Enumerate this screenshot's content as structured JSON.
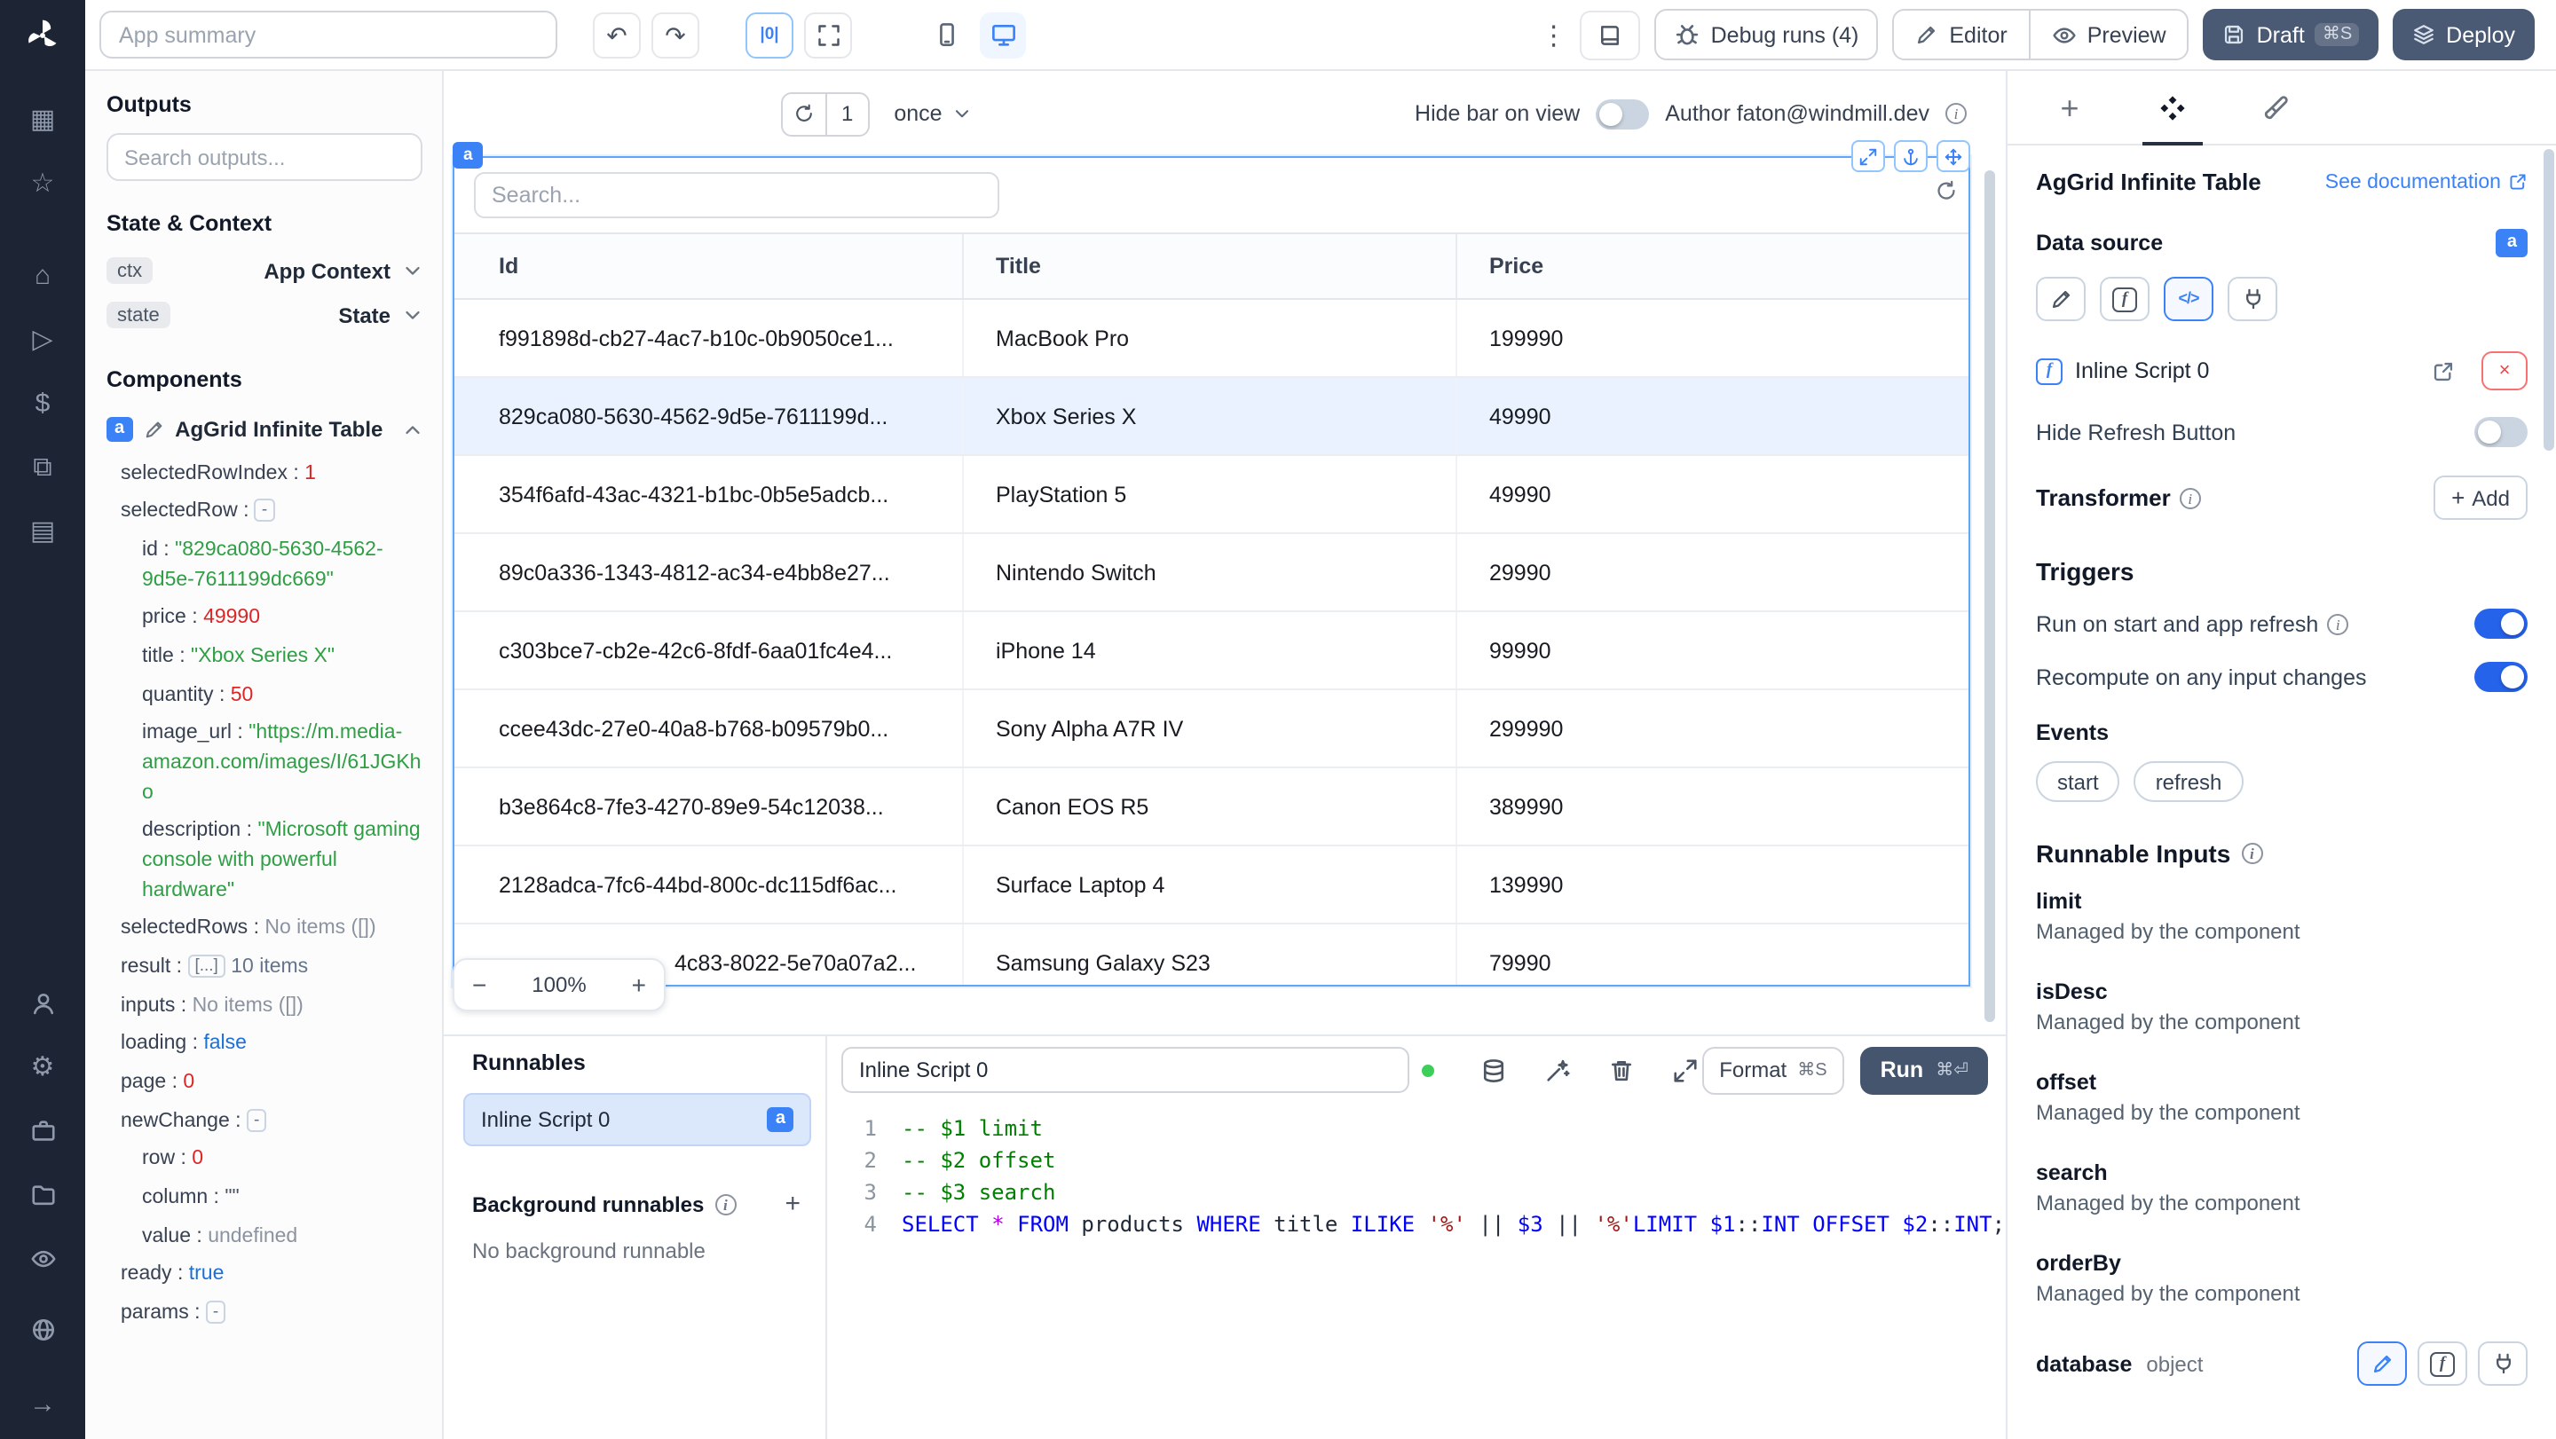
{
  "icon_glyphs": {
    "board": "▦",
    "star": "☆",
    "home": "⌂",
    "play": "▷",
    "dollar": "$",
    "apps": "⧉",
    "calendar": "▤",
    "settings": "⚙",
    "collapse": "→",
    "kebab": "⋮",
    "undo": "↶",
    "redo": "↷",
    "code": "</>",
    "plusbig": "+"
  },
  "rail": {
    "groups": [
      [
        "board",
        "star"
      ],
      [
        "home",
        "play",
        "dollar",
        "apps",
        "calendar"
      ],
      [
        "user",
        "settings",
        "briefcase",
        "folder",
        "eye"
      ],
      [
        "globe"
      ],
      [
        "collapse"
      ]
    ]
  },
  "topbar": {
    "summary_placeholder": "App summary",
    "align_icon_label": "|0|",
    "debug_runs_label": "Debug runs (4)",
    "editor_label": "Editor",
    "preview_label": "Preview",
    "draft_label": "Draft",
    "draft_shortcut": "⌘S",
    "deploy_label": "Deploy"
  },
  "outputs": {
    "title": "Outputs",
    "search_placeholder": "Search outputs...",
    "state_context_title": "State & Context",
    "ctx_key": "ctx",
    "ctx_label": "App Context",
    "state_key": "state",
    "state_label": "State",
    "components_title": "Components",
    "component_badge": "a",
    "component_name": "AgGrid Infinite Table",
    "tree": [
      {
        "key": "selectedRowIndex",
        "type": "number",
        "value": "1",
        "indent": 0
      },
      {
        "key": "selectedRow",
        "type": "chip",
        "value": "-",
        "indent": 0
      },
      {
        "key": "id",
        "type": "string",
        "value": "\"829ca080-5630-4562-9d5e-7611199dc669\"",
        "indent": 1
      },
      {
        "key": "price",
        "type": "number",
        "value": "49990",
        "indent": 1
      },
      {
        "key": "title",
        "type": "string",
        "value": "\"Xbox Series X\"",
        "indent": 1
      },
      {
        "key": "quantity",
        "type": "number",
        "value": "50",
        "indent": 1
      },
      {
        "key": "image_url",
        "type": "string",
        "value": "\"https://m.media-amazon.com/images/I/61JGKho",
        "indent": 1
      },
      {
        "key": "description",
        "type": "string",
        "value": "\"Microsoft gaming console with powerful hardware\"",
        "indent": 1
      },
      {
        "key": "selectedRows",
        "type": "empty",
        "value": "No items ([])",
        "indent": 0
      },
      {
        "key": "result",
        "type": "collapsed",
        "value": "[...]",
        "extra": "10 items",
        "indent": 0
      },
      {
        "key": "inputs",
        "type": "empty",
        "value": "No items ([])",
        "indent": 0
      },
      {
        "key": "loading",
        "type": "boolean",
        "value": "false",
        "indent": 0
      },
      {
        "key": "page",
        "type": "number",
        "value": "0",
        "indent": 0
      },
      {
        "key": "newChange",
        "type": "chip",
        "value": "-",
        "indent": 0
      },
      {
        "key": "row",
        "type": "number",
        "value": "0",
        "indent": 1
      },
      {
        "key": "column",
        "type": "plain",
        "value": "\"\"",
        "indent": 1
      },
      {
        "key": "value",
        "type": "empty",
        "value": "undefined",
        "indent": 1
      },
      {
        "key": "ready",
        "type": "boolean",
        "value": "true",
        "indent": 0
      },
      {
        "key": "params",
        "type": "chip",
        "value": "-",
        "indent": 0
      }
    ]
  },
  "canvas": {
    "refresh_count": "1",
    "frequency": "once",
    "hide_bar_label": "Hide bar on view",
    "author_label": "Author faton@windmill.dev",
    "component_tag": "a",
    "zoom_level": "100%",
    "zoom_out": "−",
    "zoom_in": "+",
    "table": {
      "search_placeholder": "Search...",
      "columns": [
        "Id",
        "Title",
        "Price"
      ],
      "rows": [
        {
          "id": "f991898d-cb27-4ac7-b10c-0b9050ce1...",
          "title": "MacBook Pro",
          "price": "199990"
        },
        {
          "id": "829ca080-5630-4562-9d5e-7611199d...",
          "title": "Xbox Series X",
          "price": "49990",
          "selected": true
        },
        {
          "id": "354f6afd-43ac-4321-b1bc-0b5e5adcb...",
          "title": "PlayStation 5",
          "price": "49990"
        },
        {
          "id": "89c0a336-1343-4812-ac34-e4bb8e27...",
          "title": "Nintendo Switch",
          "price": "29990"
        },
        {
          "id": "c303bce7-cb2e-42c6-8fdf-6aa01fc4e4...",
          "title": "iPhone 14",
          "price": "99990"
        },
        {
          "id": "ccee43dc-27e0-40a8-b768-b09579b0...",
          "title": "Sony Alpha A7R IV",
          "price": "299990"
        },
        {
          "id": "b3e864c8-7fe3-4270-89e9-54c12038...",
          "title": "Canon EOS R5",
          "price": "389990"
        },
        {
          "id": "2128adca-7fc6-44bd-800c-dc115df6ac...",
          "title": "Surface Laptop 4",
          "price": "139990"
        },
        {
          "id": "4c83-8022-5e70a07a2...",
          "title": "Samsung Galaxy S23",
          "price": "79990",
          "partial": true
        }
      ]
    }
  },
  "runnables": {
    "title": "Runnables",
    "items": [
      {
        "label": "Inline Script 0",
        "badge": "a"
      }
    ],
    "background_title": "Background runnables",
    "background_empty": "No background runnable"
  },
  "editor": {
    "tab_label": "Inline Script 0",
    "format_label": "Format",
    "format_shortcut": "⌘S",
    "run_label": "Run",
    "run_shortcut": "⌘⏎",
    "lines": [
      {
        "num": "1",
        "tokens": [
          {
            "text": "-- $1 limit",
            "type": "comment"
          }
        ]
      },
      {
        "num": "2",
        "tokens": [
          {
            "text": "-- $2 offset",
            "type": "comment"
          }
        ]
      },
      {
        "num": "3",
        "tokens": [
          {
            "text": "-- $3 search",
            "type": "comment"
          }
        ]
      },
      {
        "num": "4",
        "tokens": [
          {
            "text": "SELECT",
            "type": "keyword"
          },
          {
            "text": " ",
            "type": "plain"
          },
          {
            "text": "*",
            "type": "operator"
          },
          {
            "text": " ",
            "type": "plain"
          },
          {
            "text": "FROM",
            "type": "keyword"
          },
          {
            "text": " products ",
            "type": "plain"
          },
          {
            "text": "WHERE",
            "type": "keyword"
          },
          {
            "text": " title ",
            "type": "plain"
          },
          {
            "text": "ILIKE",
            "type": "keyword"
          },
          {
            "text": " ",
            "type": "plain"
          },
          {
            "text": "'%'",
            "type": "string"
          },
          {
            "text": " || ",
            "type": "plain"
          },
          {
            "text": "$3",
            "type": "keyword"
          },
          {
            "text": " || ",
            "type": "plain"
          },
          {
            "text": "'%'",
            "type": "string"
          },
          {
            "text": "LIMIT",
            "type": "keyword"
          },
          {
            "text": " ",
            "type": "plain"
          },
          {
            "text": "$1",
            "type": "keyword"
          },
          {
            "text": "::",
            "type": "plain"
          },
          {
            "text": "INT",
            "type": "keyword"
          },
          {
            "text": " ",
            "type": "plain"
          },
          {
            "text": "OFFSET",
            "type": "keyword"
          },
          {
            "text": " ",
            "type": "plain"
          },
          {
            "text": "$2",
            "type": "keyword"
          },
          {
            "text": "::",
            "type": "plain"
          },
          {
            "text": "INT",
            "type": "keyword"
          },
          {
            "text": ";",
            "type": "plain"
          }
        ]
      }
    ]
  },
  "right_panel": {
    "component_title": "AgGrid Infinite Table",
    "doc_link_label": "See documentation",
    "data_source_label": "Data source",
    "data_source_badge": "a",
    "script_label": "Inline Script 0",
    "remove_label": "×",
    "hide_refresh_label": "Hide Refresh Button",
    "transformer_label": "Transformer",
    "add_button_label": "Add",
    "add_button_plus": "+",
    "triggers_title": "Triggers",
    "trigger_run_on_start": "Run on start and app refresh",
    "trigger_recompute": "Recompute on any input changes",
    "events_label": "Events",
    "events": [
      "start",
      "refresh"
    ],
    "runnable_inputs_title": "Runnable Inputs",
    "managed_text": "Managed by the component",
    "inputs": [
      "limit",
      "isDesc",
      "offset",
      "search",
      "orderBy"
    ],
    "database_label": "database",
    "database_type": "object",
    "fn_glyph": "f"
  }
}
